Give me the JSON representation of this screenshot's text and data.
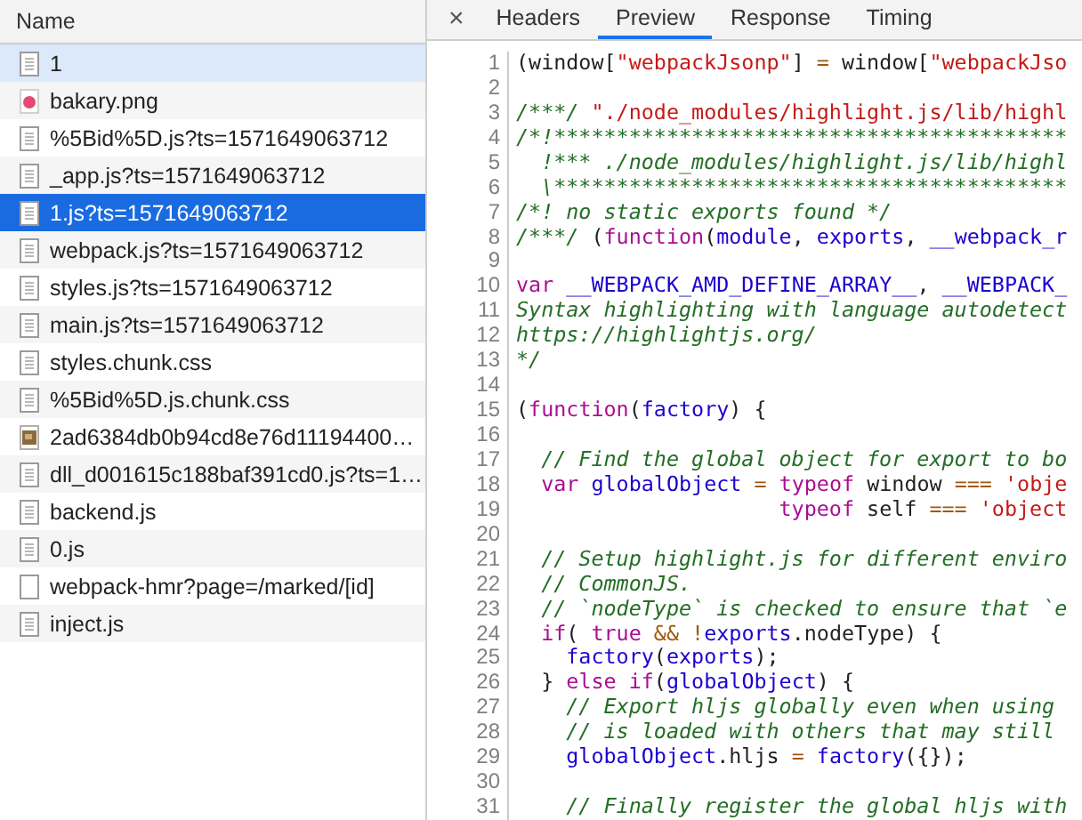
{
  "file_list": {
    "header": "Name",
    "rows": [
      {
        "name": "1",
        "kind": "document",
        "selected": false,
        "hovered": true
      },
      {
        "name": "bakary.png",
        "kind": "image",
        "selected": false,
        "hovered": false
      },
      {
        "name": "%5Bid%5D.js?ts=1571649063712",
        "kind": "document",
        "selected": false,
        "hovered": false
      },
      {
        "name": "_app.js?ts=1571649063712",
        "kind": "document",
        "selected": false,
        "hovered": false
      },
      {
        "name": "1.js?ts=1571649063712",
        "kind": "document",
        "selected": true,
        "hovered": false
      },
      {
        "name": "webpack.js?ts=1571649063712",
        "kind": "document",
        "selected": false,
        "hovered": false
      },
      {
        "name": "styles.js?ts=1571649063712",
        "kind": "document",
        "selected": false,
        "hovered": false
      },
      {
        "name": "main.js?ts=1571649063712",
        "kind": "document",
        "selected": false,
        "hovered": false
      },
      {
        "name": "styles.chunk.css",
        "kind": "document",
        "selected": false,
        "hovered": false
      },
      {
        "name": "%5Bid%5D.js.chunk.css",
        "kind": "document",
        "selected": false,
        "hovered": false
      },
      {
        "name": "2ad6384db0b94cd8e76d11194400…",
        "kind": "thumbnail",
        "selected": false,
        "hovered": false
      },
      {
        "name": "dll_d001615c188baf391cd0.js?ts=1…",
        "kind": "document",
        "selected": false,
        "hovered": false
      },
      {
        "name": "backend.js",
        "kind": "document",
        "selected": false,
        "hovered": false
      },
      {
        "name": "0.js",
        "kind": "document",
        "selected": false,
        "hovered": false
      },
      {
        "name": "webpack-hmr?page=/marked/[id]",
        "kind": "blank",
        "selected": false,
        "hovered": false
      },
      {
        "name": "inject.js",
        "kind": "document",
        "selected": false,
        "hovered": false
      }
    ]
  },
  "detail": {
    "close": "×",
    "tabs": [
      {
        "label": "Headers",
        "selected": false
      },
      {
        "label": "Preview",
        "selected": true
      },
      {
        "label": "Response",
        "selected": false
      },
      {
        "label": "Timing",
        "selected": false
      }
    ],
    "code_lines": [
      {
        "number": "1",
        "tokens": [
          {
            "kind": "plain",
            "text": "(window["
          },
          {
            "kind": "string",
            "text": "\"webpackJsonp\""
          },
          {
            "kind": "plain",
            "text": "] "
          },
          {
            "kind": "operator",
            "text": "="
          },
          {
            "kind": "plain",
            "text": " window["
          },
          {
            "kind": "string",
            "text": "\"webpackJso"
          }
        ]
      },
      {
        "number": "2"
      },
      {
        "number": "3",
        "tokens": [
          {
            "kind": "comment",
            "text": "/***/ "
          },
          {
            "kind": "string",
            "text": "\"./node_modules/highlight.js/lib/highl"
          }
        ]
      },
      {
        "number": "4",
        "tokens": [
          {
            "kind": "comment",
            "text": "/*!*****************************************"
          }
        ]
      },
      {
        "number": "5",
        "tokens": [
          {
            "kind": "comment",
            "text": "  !*** ./node_modules/highlight.js/lib/highl"
          }
        ]
      },
      {
        "number": "6",
        "tokens": [
          {
            "kind": "comment",
            "text": "  \\*****************************************"
          }
        ]
      },
      {
        "number": "7",
        "tokens": [
          {
            "kind": "comment",
            "text": "/*! no static exports found */"
          }
        ]
      },
      {
        "number": "8",
        "tokens": [
          {
            "kind": "comment",
            "text": "/***/"
          },
          {
            "kind": "plain",
            "text": " ("
          },
          {
            "kind": "keyword",
            "text": "function"
          },
          {
            "kind": "plain",
            "text": "("
          },
          {
            "kind": "variable",
            "text": "module"
          },
          {
            "kind": "plain",
            "text": ", "
          },
          {
            "kind": "variable",
            "text": "exports"
          },
          {
            "kind": "plain",
            "text": ", "
          },
          {
            "kind": "variable",
            "text": "__webpack_r"
          }
        ]
      },
      {
        "number": "9"
      },
      {
        "number": "10",
        "tokens": [
          {
            "kind": "keyword",
            "text": "var "
          },
          {
            "kind": "variable",
            "text": "__WEBPACK_AMD_DEFINE_ARRAY__"
          },
          {
            "kind": "plain",
            "text": ", "
          },
          {
            "kind": "variable",
            "text": "__WEBPACK_"
          }
        ]
      },
      {
        "number": "11",
        "tokens": [
          {
            "kind": "comment",
            "text": "Syntax highlighting with language autodetect"
          }
        ]
      },
      {
        "number": "12",
        "tokens": [
          {
            "kind": "comment",
            "text": "https://highlightjs.org/"
          }
        ]
      },
      {
        "number": "13",
        "tokens": [
          {
            "kind": "comment",
            "text": "*/"
          }
        ]
      },
      {
        "number": "14"
      },
      {
        "number": "15",
        "tokens": [
          {
            "kind": "plain",
            "text": "("
          },
          {
            "kind": "keyword",
            "text": "function"
          },
          {
            "kind": "plain",
            "text": "("
          },
          {
            "kind": "variable",
            "text": "factory"
          },
          {
            "kind": "plain",
            "text": ") {"
          }
        ]
      },
      {
        "number": "16"
      },
      {
        "number": "17",
        "tokens": [
          {
            "kind": "comment",
            "text": "  // Find the global object for export to bo"
          }
        ]
      },
      {
        "number": "18",
        "tokens": [
          {
            "kind": "keyword",
            "text": "  var "
          },
          {
            "kind": "variable",
            "text": "globalObject"
          },
          {
            "kind": "operator",
            "text": " = "
          },
          {
            "kind": "keyword",
            "text": "typeof"
          },
          {
            "kind": "plain",
            "text": " window "
          },
          {
            "kind": "operator",
            "text": "=== "
          },
          {
            "kind": "string",
            "text": "'obje"
          }
        ]
      },
      {
        "number": "19",
        "tokens": [
          {
            "kind": "keyword",
            "text": "                     typeof"
          },
          {
            "kind": "plain",
            "text": " self "
          },
          {
            "kind": "operator",
            "text": "=== "
          },
          {
            "kind": "string",
            "text": "'object"
          }
        ]
      },
      {
        "number": "20"
      },
      {
        "number": "21",
        "tokens": [
          {
            "kind": "comment",
            "text": "  // Setup highlight.js for different enviro"
          }
        ]
      },
      {
        "number": "22",
        "tokens": [
          {
            "kind": "comment",
            "text": "  // CommonJS."
          }
        ]
      },
      {
        "number": "23",
        "tokens": [
          {
            "kind": "comment",
            "text": "  // `nodeType` is checked to ensure that `e"
          }
        ]
      },
      {
        "number": "24",
        "tokens": [
          {
            "kind": "keyword",
            "text": "  if"
          },
          {
            "kind": "plain",
            "text": "( "
          },
          {
            "kind": "keyword",
            "text": "true "
          },
          {
            "kind": "operator",
            "text": "&& !"
          },
          {
            "kind": "variable",
            "text": "exports"
          },
          {
            "kind": "plain",
            "text": ".nodeType) {"
          }
        ]
      },
      {
        "number": "25",
        "tokens": [
          {
            "kind": "variable",
            "text": "    factory"
          },
          {
            "kind": "plain",
            "text": "("
          },
          {
            "kind": "variable",
            "text": "exports"
          },
          {
            "kind": "plain",
            "text": ");"
          }
        ]
      },
      {
        "number": "26",
        "tokens": [
          {
            "kind": "plain",
            "text": "  } "
          },
          {
            "kind": "keyword",
            "text": "else if"
          },
          {
            "kind": "plain",
            "text": "("
          },
          {
            "kind": "variable",
            "text": "globalObject"
          },
          {
            "kind": "plain",
            "text": ") {"
          }
        ]
      },
      {
        "number": "27",
        "tokens": [
          {
            "kind": "comment",
            "text": "    // Export hljs globally even when using"
          }
        ]
      },
      {
        "number": "28",
        "tokens": [
          {
            "kind": "comment",
            "text": "    // is loaded with others that may still"
          }
        ]
      },
      {
        "number": "29",
        "tokens": [
          {
            "kind": "variable",
            "text": "    globalObject"
          },
          {
            "kind": "plain",
            "text": ".hljs "
          },
          {
            "kind": "operator",
            "text": "= "
          },
          {
            "kind": "variable",
            "text": "factory"
          },
          {
            "kind": "plain",
            "text": "({});"
          }
        ]
      },
      {
        "number": "30"
      },
      {
        "number": "31",
        "tokens": [
          {
            "kind": "comment",
            "text": "    // Finally register the global hljs with"
          }
        ]
      }
    ]
  }
}
